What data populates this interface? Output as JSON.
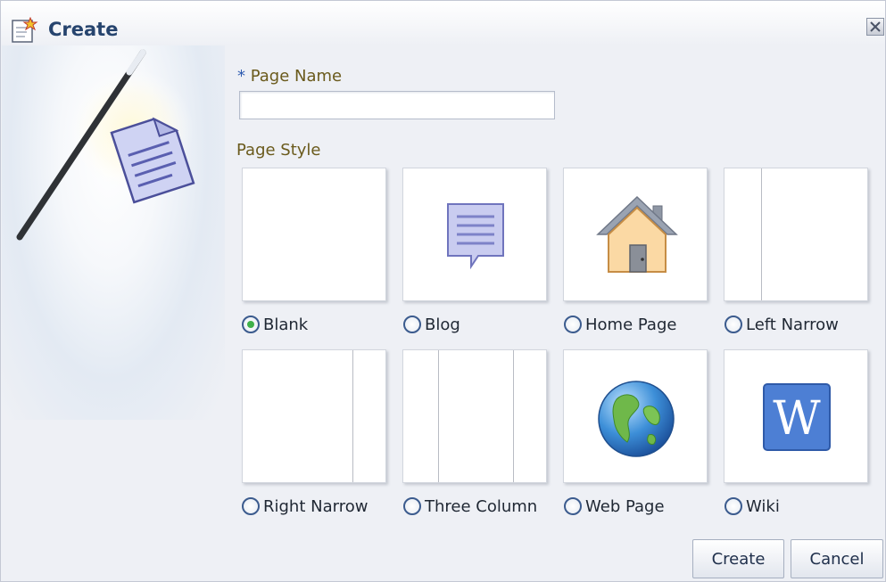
{
  "dialog": {
    "title": "Create",
    "close_icon": "close-icon",
    "title_icon": "new-page-icon"
  },
  "form": {
    "required_marker": "*",
    "page_name_label": "Page Name",
    "page_name_value": "",
    "page_style_label": "Page Style",
    "selected_style": "Blank"
  },
  "styles": [
    {
      "label": "Blank",
      "icon": "blank-layout",
      "checked": true
    },
    {
      "label": "Blog",
      "icon": "blog-icon",
      "checked": false
    },
    {
      "label": "Home Page",
      "icon": "house-icon",
      "checked": false
    },
    {
      "label": "Left Narrow",
      "icon": "left-narrow-layout",
      "checked": false
    },
    {
      "label": "Right Narrow",
      "icon": "right-narrow-layout",
      "checked": false
    },
    {
      "label": "Three Column",
      "icon": "three-column-layout",
      "checked": false
    },
    {
      "label": "Web Page",
      "icon": "globe-icon",
      "checked": false
    },
    {
      "label": "Wiki",
      "icon": "wiki-w-icon",
      "checked": false
    }
  ],
  "buttons": {
    "create_label": "Create",
    "cancel_label": "Cancel"
  },
  "colors": {
    "title": "#26446e",
    "label": "#6a5a1c",
    "required": "#2e5bb0",
    "radio_selected": "#3fb04a",
    "background": "#eef0f5"
  }
}
